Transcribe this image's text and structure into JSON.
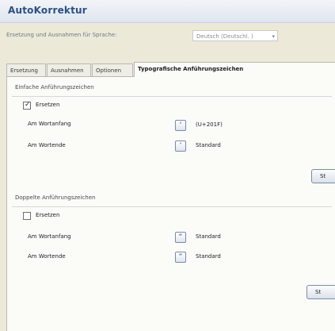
{
  "window": {
    "title": "AutoKorrektur"
  },
  "language": {
    "label": "Ersetzung und Ausnahmen für Sprache:",
    "selected": "Deutsch (Deutschl. )"
  },
  "tabs": [
    {
      "label": "Ersetzung"
    },
    {
      "label": "Ausnahmen"
    },
    {
      "label": "Optionen"
    },
    {
      "label": "Typografische Anführungszeichen"
    }
  ],
  "single": {
    "title": "Einfache Anführungszeichen",
    "replace_label": "Ersetzen",
    "start_label": "Am Wortanfang",
    "start_glyph": "‘",
    "start_value": "(U+201F)",
    "end_label": "Am Wortende",
    "end_glyph": "’",
    "end_value": "Standard",
    "reset_label": "St"
  },
  "double": {
    "title": "Doppelte Anführungszeichen",
    "replace_label": "Ersetzen",
    "start_label": "Am Wortanfang",
    "start_glyph": "“",
    "start_value": "Standard",
    "end_label": "Am Wortende",
    "end_glyph": "”",
    "end_value": "Standard",
    "reset_label": "St"
  }
}
